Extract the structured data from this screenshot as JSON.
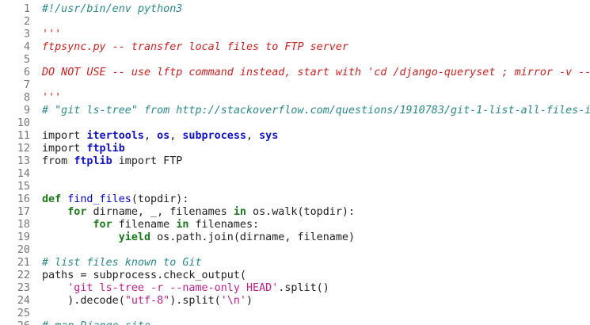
{
  "editor": {
    "language": "python",
    "colors": {
      "comment": "#2a8a8a",
      "docstring": "#d32020",
      "keyword": "#1a7a1a",
      "namespace": "#1010c8",
      "function": "#0000d0",
      "string": "#c0208a",
      "line_number": "#777777"
    },
    "lines": [
      {
        "n": "1",
        "tokens": [
          {
            "t": "comment",
            "s": "#!/usr/bin/env python3"
          }
        ]
      },
      {
        "n": "2",
        "tokens": []
      },
      {
        "n": "3",
        "tokens": [
          {
            "t": "red",
            "s": "'''"
          }
        ]
      },
      {
        "n": "4",
        "tokens": [
          {
            "t": "red",
            "s": "ftpsync.py -- transfer local files to FTP server"
          }
        ]
      },
      {
        "n": "5",
        "tokens": []
      },
      {
        "n": "6",
        "tokens": [
          {
            "t": "red",
            "s": "DO NOT USE -- use lftp command instead, start with 'cd /django-queryset ; mirror -v --r"
          }
        ]
      },
      {
        "n": "7",
        "tokens": []
      },
      {
        "n": "8",
        "tokens": [
          {
            "t": "red",
            "s": "'''"
          }
        ]
      },
      {
        "n": "9",
        "tokens": [
          {
            "t": "comment",
            "s": "# \"git ls-tree\" from http://stackoverflow.com/questions/1910783/git-1-list-all-files-in"
          }
        ]
      },
      {
        "n": "10",
        "tokens": []
      },
      {
        "n": "11",
        "tokens": [
          {
            "t": "plain",
            "s": "import "
          },
          {
            "t": "ns",
            "s": "itertools"
          },
          {
            "t": "plain",
            "s": ", "
          },
          {
            "t": "ns",
            "s": "os"
          },
          {
            "t": "plain",
            "s": ", "
          },
          {
            "t": "ns",
            "s": "subprocess"
          },
          {
            "t": "plain",
            "s": ", "
          },
          {
            "t": "ns",
            "s": "sys"
          }
        ]
      },
      {
        "n": "12",
        "tokens": [
          {
            "t": "plain",
            "s": "import "
          },
          {
            "t": "ns",
            "s": "ftplib"
          }
        ]
      },
      {
        "n": "13",
        "tokens": [
          {
            "t": "plain",
            "s": "from "
          },
          {
            "t": "ns",
            "s": "ftplib"
          },
          {
            "t": "plain",
            "s": " import FTP"
          }
        ]
      },
      {
        "n": "14",
        "tokens": []
      },
      {
        "n": "15",
        "tokens": []
      },
      {
        "n": "16",
        "tokens": [
          {
            "t": "kw",
            "s": "def "
          },
          {
            "t": "fn",
            "s": "find_files"
          },
          {
            "t": "plain",
            "s": "(topdir):"
          }
        ]
      },
      {
        "n": "17",
        "tokens": [
          {
            "t": "plain",
            "s": "    "
          },
          {
            "t": "kw",
            "s": "for"
          },
          {
            "t": "plain",
            "s": " dirname, _, filenames "
          },
          {
            "t": "kw",
            "s": "in"
          },
          {
            "t": "plain",
            "s": " os.walk(topdir):"
          }
        ]
      },
      {
        "n": "18",
        "tokens": [
          {
            "t": "plain",
            "s": "        "
          },
          {
            "t": "kw",
            "s": "for"
          },
          {
            "t": "plain",
            "s": " filename "
          },
          {
            "t": "kw",
            "s": "in"
          },
          {
            "t": "plain",
            "s": " filenames:"
          }
        ]
      },
      {
        "n": "19",
        "tokens": [
          {
            "t": "plain",
            "s": "            "
          },
          {
            "t": "kw",
            "s": "yield"
          },
          {
            "t": "plain",
            "s": " os.path.join(dirname, filename)"
          }
        ]
      },
      {
        "n": "20",
        "tokens": []
      },
      {
        "n": "21",
        "tokens": [
          {
            "t": "comment",
            "s": "# list files known to Git"
          }
        ]
      },
      {
        "n": "22",
        "tokens": [
          {
            "t": "plain",
            "s": "paths = subprocess.check_output("
          }
        ]
      },
      {
        "n": "23",
        "tokens": [
          {
            "t": "plain",
            "s": "    "
          },
          {
            "t": "str",
            "s": "'git ls-tree -r --name-only HEAD'"
          },
          {
            "t": "plain",
            "s": ".split()"
          }
        ]
      },
      {
        "n": "24",
        "tokens": [
          {
            "t": "plain",
            "s": "    ).decode("
          },
          {
            "t": "str",
            "s": "\"utf-8\""
          },
          {
            "t": "plain",
            "s": ").split("
          },
          {
            "t": "str",
            "s": "'\\n'"
          },
          {
            "t": "plain",
            "s": ")"
          }
        ]
      },
      {
        "n": "25",
        "tokens": []
      },
      {
        "n": "26",
        "tokens": [
          {
            "t": "comment",
            "s": "# map Django site"
          }
        ]
      }
    ]
  }
}
